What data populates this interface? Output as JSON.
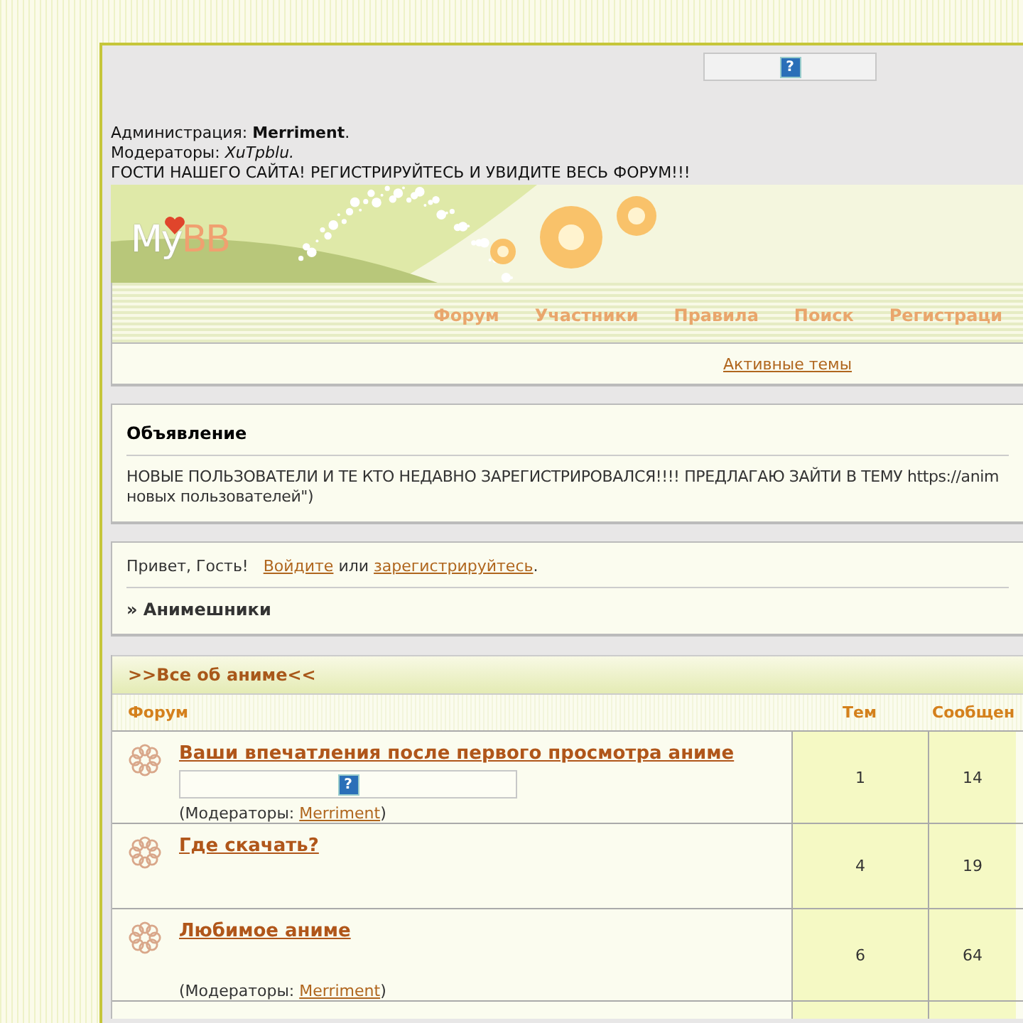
{
  "top_image_icon": "?",
  "header": {
    "administration": "Администрация: **Merriment**.",
    "moderators": "Модераторы: *XuTpblu.*",
    "guest_notice": "ГОСТИ НАШЕГО САЙТА! РЕГИСТРИРУЙТЕСЬ И УВИДИТЕ ВЕСЬ ФОРУМ!!!"
  },
  "logo": {
    "part_1": "My",
    "part_2": "BB"
  },
  "nav": [
    "Форум",
    "Участники",
    "Правила",
    "Поиск",
    "Регистраци"
  ],
  "active_topics": "Активные темы",
  "announcement": {
    "title": "Объявление",
    "text": "НОВЫЕ ПОЛЬЗОВАТЕЛИ И ТЕ КТО НЕДАВНО ЗАРЕГИСТРИРОВАЛСЯ!!!! ПРЕДЛАГАЮ ЗАЙТИ В ТЕМУ https://anim",
    "text_line_2": "новых пользователей\")"
  },
  "welcome": {
    "greeting": "Привет, Гость!",
    "login": "Войдите",
    "or": " или ",
    "register": "зарегистрируйтесь",
    "end": "."
  },
  "breadcrumb": "» Анимешники",
  "category": {
    "title": ">>Все об аниме<<",
    "columns": [
      "Форум",
      "Тем",
      "Сообщен"
    ],
    "rows": [
      {
        "title": "Ваши впечатления после первого просмотра аниме",
        "image_icon": "?",
        "moderators": {
          "prefix": "(Модераторы: ",
          "name": "Merriment",
          "suffix": ")"
        },
        "topics": "1",
        "posts": "14"
      },
      {
        "title": "Где скачать?",
        "topics": "4",
        "posts": "19"
      },
      {
        "title": "Любимое аниме",
        "moderators": {
          "prefix": "(Модераторы: ",
          "name": "Merriment",
          "suffix": ")"
        },
        "topics": "6",
        "posts": "64"
      }
    ]
  }
}
